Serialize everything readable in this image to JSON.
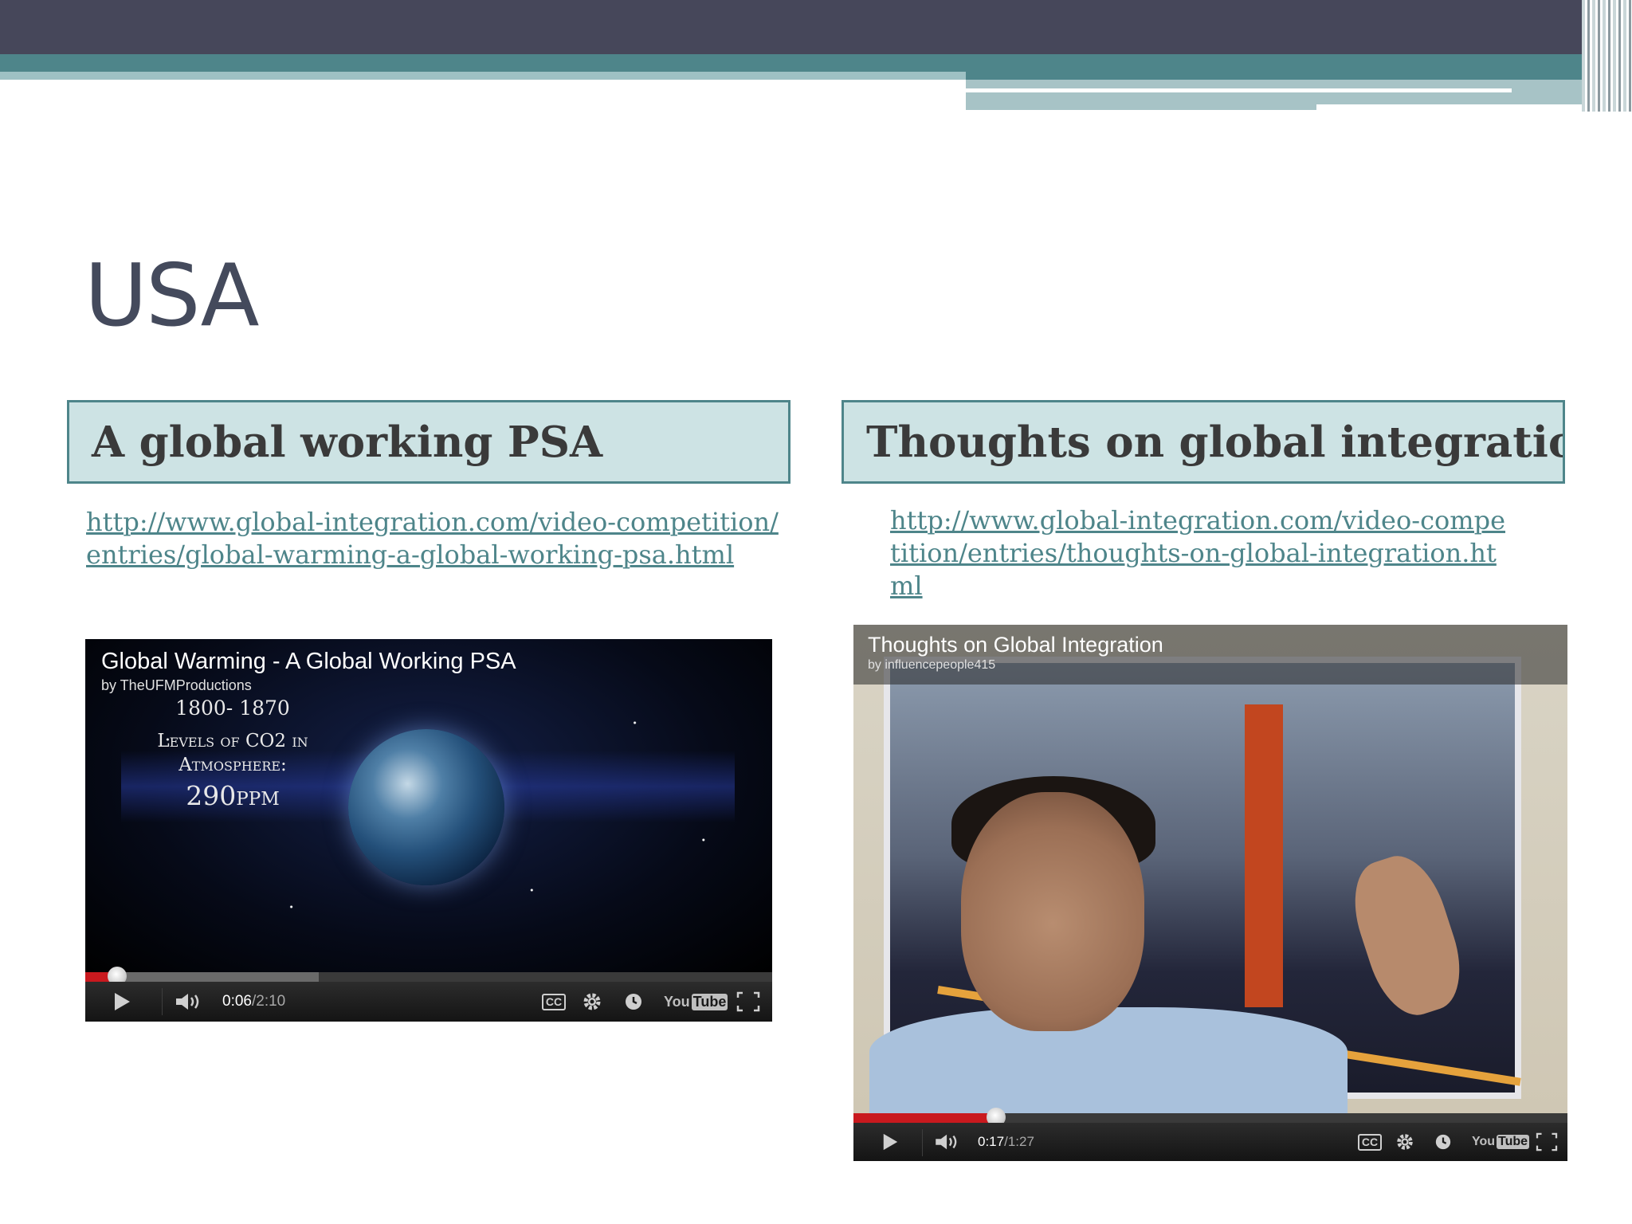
{
  "slide": {
    "title": "USA"
  },
  "left_panel": {
    "heading": "A global working PSA",
    "link": "http://www.global-integration.com/video-competition/entries/global-warming-a-global-working-psa.html",
    "video": {
      "title": "Global Warming - A Global Working PSA",
      "author": "by TheUFMProductions",
      "caption_years": "1800- 1870",
      "caption_levels": "Levels of CO2 in",
      "caption_atmosphere": "Atmosphere:",
      "caption_ppm": "290ppm",
      "time_current": "0:06",
      "time_separator": " / ",
      "time_total": "2:10",
      "played_fraction": 0.046,
      "buffered_fraction": 0.34,
      "cc_label": "CC",
      "logo_you": "You",
      "logo_tube": "Tube"
    }
  },
  "right_panel": {
    "heading": "Thoughts on global integration",
    "link": "http://www.global-integration.com/video-competition/entries/thoughts-on-global-integration.html",
    "video": {
      "title": "Thoughts on Global Integration",
      "author": "by influencepeople415",
      "time_current": "0:17",
      "time_separator": " / ",
      "time_total": "1:27",
      "played_fraction": 0.2,
      "buffered_fraction": 0.2,
      "cc_label": "CC",
      "logo_you": "You",
      "logo_tube": "Tube"
    }
  },
  "colors": {
    "banner_dark": "#46475a",
    "banner_teal": "#4e858a",
    "heading_fill": "#cde3e4",
    "link": "#4e858a",
    "progress_played": "#c9191e"
  },
  "icons": [
    "play-icon",
    "volume-icon",
    "cc-icon",
    "settings-gear-icon",
    "watch-later-clock-icon",
    "youtube-logo",
    "fullscreen-icon"
  ]
}
